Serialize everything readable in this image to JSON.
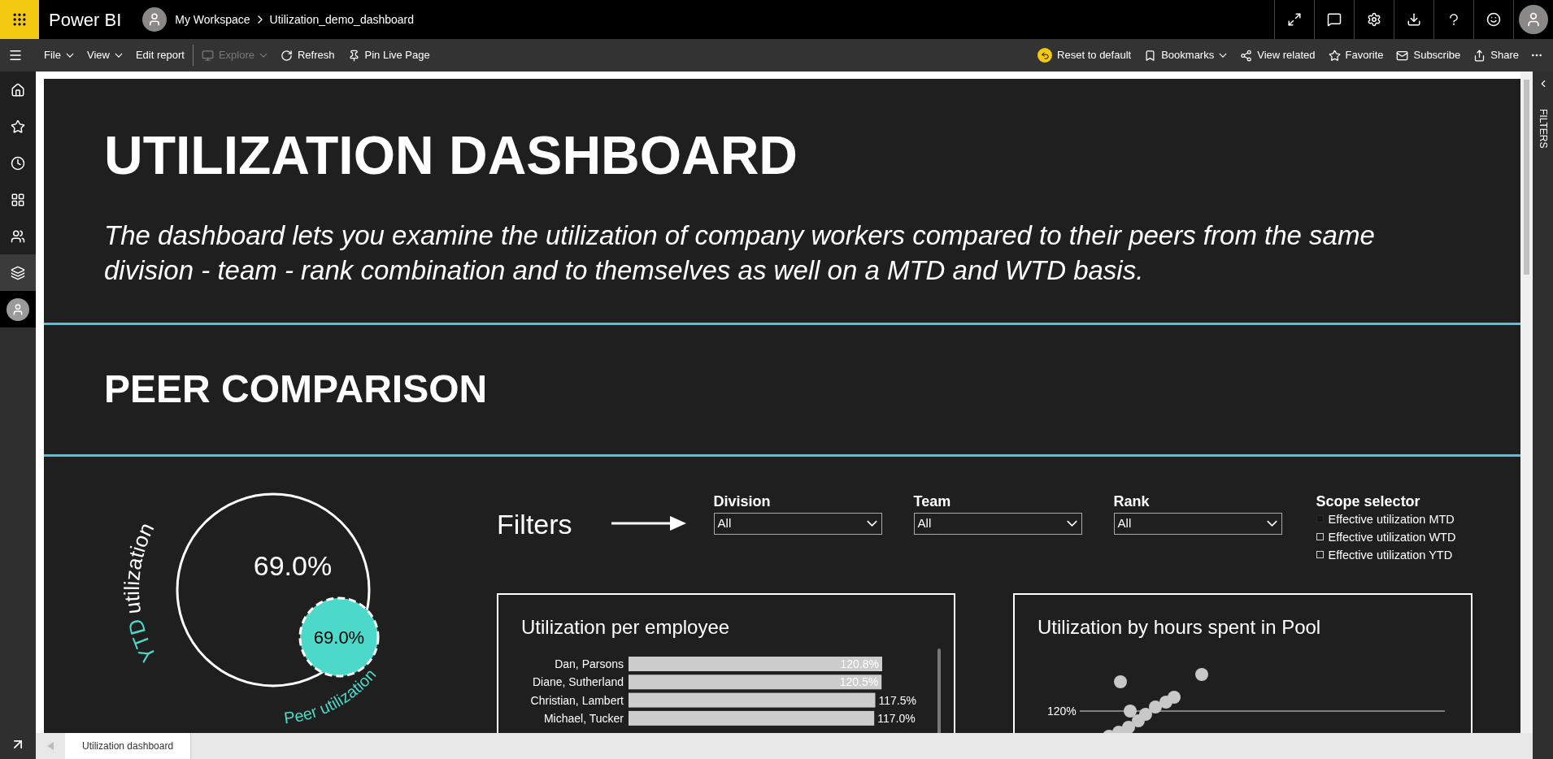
{
  "app": {
    "name": "Power BI"
  },
  "breadcrumb": [
    "My Workspace",
    "Utilization_demo_dashboard"
  ],
  "toolbar_left": [
    {
      "label": "File",
      "kind": "menu",
      "disabled": false
    },
    {
      "label": "View",
      "kind": "menu",
      "disabled": false
    },
    {
      "label": "Edit report",
      "kind": "button",
      "disabled": false
    },
    {
      "label": "Explore",
      "kind": "menu",
      "disabled": true
    },
    {
      "label": "Refresh",
      "kind": "button",
      "disabled": false
    },
    {
      "label": "Pin Live Page",
      "kind": "button",
      "disabled": false
    }
  ],
  "toolbar_right": [
    {
      "label": "Reset to default",
      "kind": "button"
    },
    {
      "label": "Bookmarks",
      "kind": "menu"
    },
    {
      "label": "View related",
      "kind": "button"
    },
    {
      "label": "Favorite",
      "kind": "button"
    },
    {
      "label": "Subscribe",
      "kind": "button"
    },
    {
      "label": "Share",
      "kind": "button"
    }
  ],
  "nav": [
    {
      "selected": false
    },
    {
      "selected": false
    },
    {
      "selected": false
    },
    {
      "selected": false
    },
    {
      "selected": false
    },
    {
      "selected": true
    }
  ],
  "report": {
    "title": "UTILIZATION DASHBOARD",
    "description": "The dashboard lets you examine the utilization of company workers compared to their peers from the same division - team - rank combination and to themselves as well on a MTD and WTD basis.",
    "section_title": "PEER COMPARISON",
    "gauge": {
      "value": "69.0%",
      "peer_value": "69.0%",
      "label_highlight": "YTD",
      "label_rest": "utilization",
      "peer_label": "Peer utilization"
    },
    "filters_label": "Filters",
    "dropdowns": [
      {
        "label": "Division",
        "value": "All"
      },
      {
        "label": "Team",
        "value": "All"
      },
      {
        "label": "Rank",
        "value": "All"
      }
    ],
    "scope_selector": {
      "title": "Scope selector",
      "options": [
        {
          "label": "Effective utilization MTD",
          "selected": true
        },
        {
          "label": "Effective utilization WTD",
          "selected": false
        },
        {
          "label": "Effective utilization YTD",
          "selected": false
        }
      ]
    },
    "employee_card": {
      "title": "Utilization per employee",
      "chart_data": {
        "type": "bar",
        "orientation": "horizontal",
        "categories": [
          "Dan, Parsons",
          "Diane, Sutherland",
          "Christian, Lambert",
          "Michael, Tucker"
        ],
        "values": [
          120.8,
          120.5,
          117.5,
          117.0
        ],
        "value_labels": [
          "120.8%",
          "120.5%",
          "117.5%",
          "117.0%"
        ]
      }
    },
    "pool_card": {
      "title": "Utilization by hours spent in Pool",
      "gridline_label": "120%"
    }
  },
  "filters_pane": {
    "label": "FILTERS"
  },
  "page_tabs": [
    {
      "label": "Utilization dashboard",
      "selected": true
    }
  ]
}
